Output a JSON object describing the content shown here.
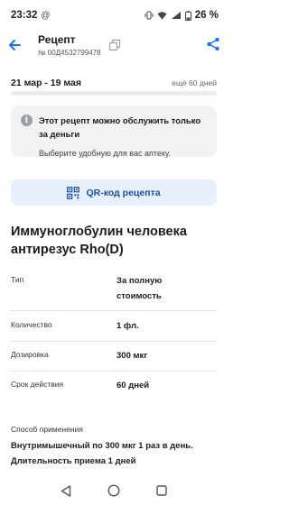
{
  "status_bar": {
    "time": "23:32",
    "notification_icon": "at-sign-icon",
    "battery_text": "26 %"
  },
  "header": {
    "title": "Рецепт",
    "number": "№ 00Д4532799478"
  },
  "period": {
    "dates": "21 мар - 19 мая",
    "days_left": "ещё 60 дней",
    "progress": 0
  },
  "info": {
    "icon_glyph": "i",
    "title": "Этот рецепт можно обслужить только за деньги",
    "text": "Выберите удобную для вас аптеку."
  },
  "qr_button": {
    "label": "QR-код рецепта"
  },
  "drug": {
    "name": "Иммуноглобулин человека антирезус Rho(D)",
    "details": [
      {
        "label": "Тип",
        "value": "За полную стоимость"
      },
      {
        "label": "Количество",
        "value": "1 фл."
      },
      {
        "label": "Дозировка",
        "value": "300 мкг"
      },
      {
        "label": "Срок действия",
        "value": "60 дней"
      }
    ]
  },
  "usage": {
    "label": "Способ применения",
    "text": "Внутримышечный по 300 мкг 1 раз в день. Длительность приема 1 дней"
  },
  "colors": {
    "accent": "#1a73e8",
    "qr_background": "#e8f0fe",
    "info_background": "#f1f2f4"
  }
}
